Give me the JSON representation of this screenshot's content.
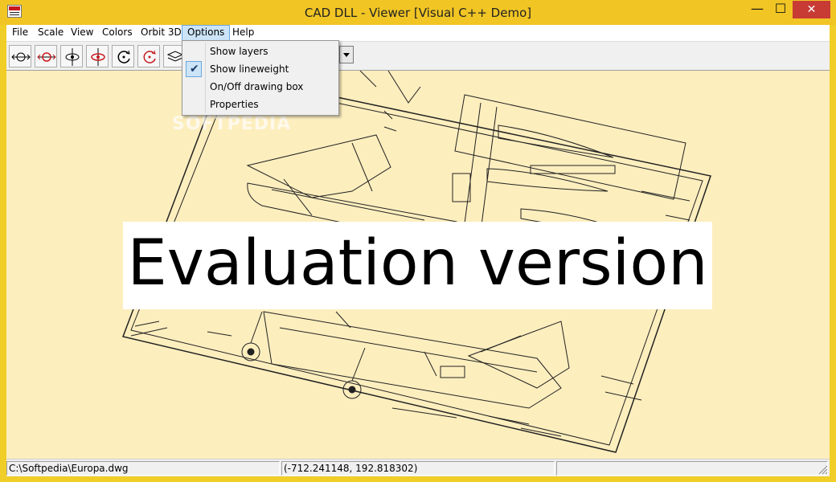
{
  "window": {
    "title": "CAD DLL - Viewer [Visual C++ Demo]",
    "minimize_glyph": "—",
    "maximize_glyph": "☐",
    "close_glyph": "✕"
  },
  "menu": {
    "items": [
      "File",
      "Scale",
      "View",
      "Colors",
      "Orbit 3D",
      "Options",
      "Help"
    ]
  },
  "toolbar": {
    "buttons": [
      {
        "icon": "pan-x-icon"
      },
      {
        "icon": "pan-x-red-icon"
      },
      {
        "icon": "rotate-y-icon"
      },
      {
        "icon": "rotate-y-red-icon"
      },
      {
        "icon": "rotate-z-icon"
      },
      {
        "icon": "rotate-z-red-icon"
      },
      {
        "icon": "layers-icon"
      }
    ]
  },
  "options_menu": {
    "items": [
      {
        "label": "Show layers",
        "checked": false
      },
      {
        "label": "Show lineweight",
        "checked": true
      },
      {
        "label": "On/Off drawing box",
        "checked": false
      },
      {
        "label": "Properties",
        "checked": false
      }
    ]
  },
  "canvas": {
    "overlay_text": "Evaluation version",
    "watermark": "SOFTPEDIA",
    "background_color": "#fdeebe"
  },
  "status": {
    "file_path": "C:\\Softpedia\\Europa.dwg",
    "coordinates": "(-712.241148, 192.818302)",
    "extra": ""
  },
  "colors": {
    "titlebar": "#f1c524",
    "close": "#c73b34",
    "menu_highlight": "#cce4f7"
  }
}
